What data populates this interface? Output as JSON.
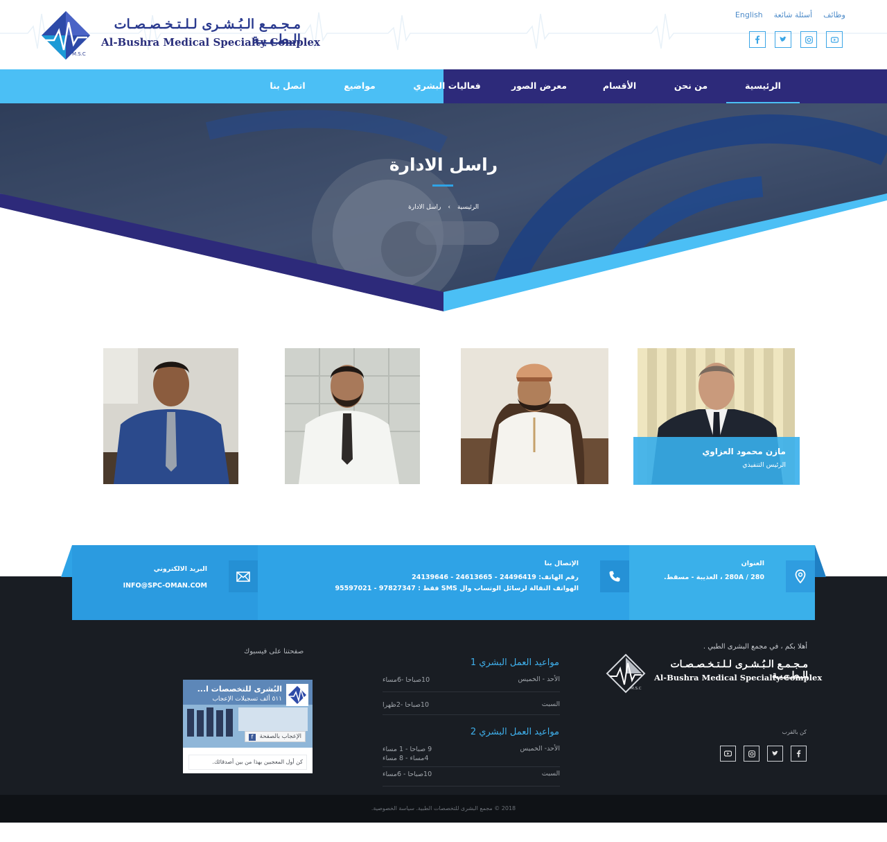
{
  "header": {
    "logo_ar": "مـجـمـع الـبُـشـرى لـلـتـخـصـصـات الـطـبـيـة",
    "logo_en": "Al-Bushra Medical Specialty Complex",
    "logo_badge": "M.S.C",
    "top_links": {
      "jobs": "وظائف",
      "faq": "أسئلة شائعة",
      "english": "English"
    },
    "social": [
      "youtube-icon",
      "instagram-icon",
      "twitter-icon",
      "facebook-icon"
    ]
  },
  "nav": {
    "home": "الرئيسية",
    "about": "من نحن",
    "departments": "الأقسام",
    "gallery": "معرض الصور",
    "events": "فعاليات البشري",
    "topics": "مواضيع",
    "contact": "اتصل بنا"
  },
  "hero": {
    "title": "راسل الادارة",
    "breadcrumb_home": "الرئيسية",
    "breadcrumb_sep": "›",
    "breadcrumb_current": "راسل الادارة"
  },
  "team": {
    "featured_name": "مازن محمود العزاوي",
    "featured_role": "الرئيس التنفيذي"
  },
  "contact_strip": {
    "address_title": "العنوان",
    "address": "280 / 280A ، العذيبة - مسقط.",
    "phone_title": "الإتصال بنا",
    "phone_line1": "رقم الهاتف: 24496419 - 24613665 - 24139646",
    "phone_line2": "الهواتف النقالة لرسائل الوتساب وال SMS فقط : 97827347 - 95597021",
    "email_title": "البريد الالكتروني",
    "email": "INFO@SPC-OMAN.COM"
  },
  "footer": {
    "welcome": "أهلا بكم ، في مجمع البشرى الطبي .",
    "logo_ar": "مـجـمـع الـبُـشـرى لـلـتـخـصـصـات الـطـبـيـة",
    "logo_en": "Al-Bushra Medical Specialty Complex",
    "logo_badge": "M.S.C",
    "stay_close": "كن بالقرب",
    "hours1_title": "مواعيد العمل البشري 1",
    "hours1_row1_day": "الأحد - الخميس",
    "hours1_row1_time": "10صباحا -6مساء",
    "hours1_row2_day": "السبت",
    "hours1_row2_time": "10صباحا -2ظهرا",
    "hours2_title": "مواعيد العمل البشري 2",
    "hours2_row1_day": "الأحد- الخميس",
    "hours2_row1_time_a": "9 صباحا - 1 مساء",
    "hours2_row1_time_b": "4مساء - 8 مساء",
    "hours2_row2_day": "السبت",
    "hours2_row2_time": "10صباحا - 6مساء",
    "fb_title": "صفحتنا على فيسبوك",
    "fb_page_name": "البُشرى للتخصصات ا...",
    "fb_likes": "٥١١ ألف تسجيلات الإعجاب",
    "fb_like_button": "الإعجاب بالصفحة",
    "fb_friends": "كن أول المعجبين بهذا من بين أصدقائك.",
    "copyright": "2018 © مجمع البشرى للتخصصات الطبية. سياسة الخصوصية."
  },
  "colors": {
    "brand_navy": "#2d2a7a",
    "brand_sky": "#4bbff5",
    "strip_blue": "#2fa3e6",
    "footer_dark": "#191d23"
  }
}
